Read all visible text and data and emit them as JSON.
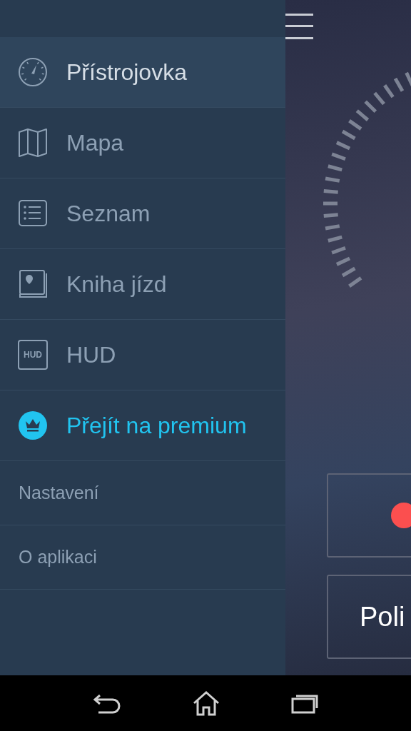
{
  "menu": [
    {
      "label": "Přístrojovka",
      "kind": "main",
      "selected": true
    },
    {
      "label": "Mapa",
      "kind": "main",
      "selected": false
    },
    {
      "label": "Seznam",
      "kind": "main",
      "selected": false
    },
    {
      "label": "Kniha jízd",
      "kind": "main",
      "selected": false
    },
    {
      "label": "HUD",
      "kind": "main",
      "selected": false
    },
    {
      "label": "Přejít na premium",
      "kind": "premium",
      "selected": false
    }
  ],
  "secondary": [
    {
      "label": "Nastavení"
    },
    {
      "label": "O aplikaci"
    }
  ],
  "hud_icon_text": "HUD",
  "main_buttons": [
    {
      "kind": "record"
    },
    {
      "kind": "text",
      "label": "Poli"
    }
  ]
}
